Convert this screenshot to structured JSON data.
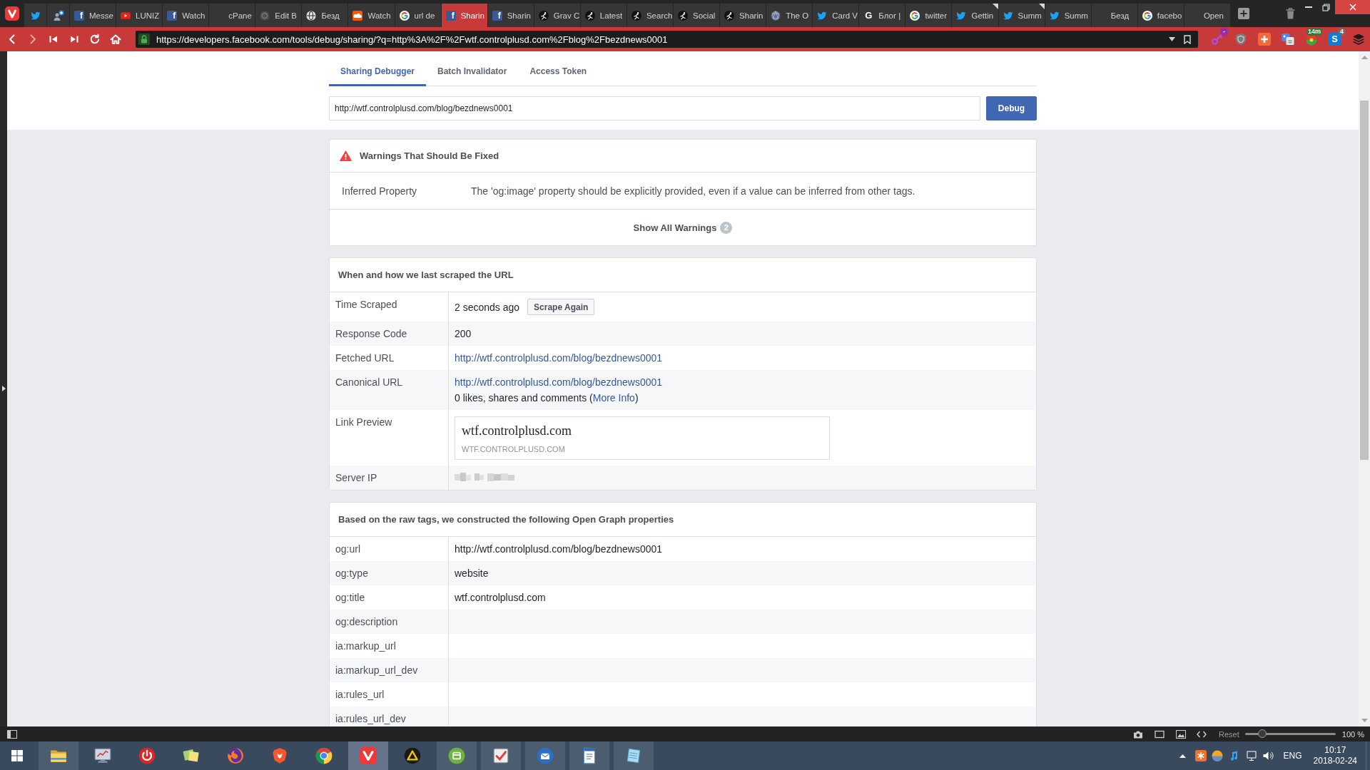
{
  "browser": {
    "pinned_tabs": [
      {
        "kind": "bird",
        "selected": false
      },
      {
        "kind": "people",
        "selected": false
      }
    ],
    "tabs": [
      {
        "kind": "letter",
        "glyph": "f",
        "label": "Messe",
        "selected": false,
        "marked": false
      },
      {
        "kind": "play",
        "label": "LUNIZ",
        "selected": false,
        "marked": false
      },
      {
        "kind": "letter",
        "glyph": "f",
        "label": "Watch",
        "selected": false,
        "marked": false
      },
      {
        "kind": "none",
        "label": "cPane",
        "selected": false,
        "marked": false
      },
      {
        "kind": "circle",
        "label": "Edit B",
        "selected": false,
        "marked": false
      },
      {
        "kind": "globe",
        "label": "Безд",
        "selected": false,
        "marked": false
      },
      {
        "kind": "cloud",
        "label": "Watch",
        "selected": false,
        "marked": false
      },
      {
        "kind": "ring",
        "label": "url de",
        "selected": false,
        "marked": false
      },
      {
        "kind": "letter",
        "glyph": "f",
        "label": "Sharin",
        "selected": true,
        "marked": false
      },
      {
        "kind": "letter",
        "glyph": "f",
        "label": "Sharin",
        "selected": false,
        "marked": false
      },
      {
        "kind": "figure",
        "label": "Grav C",
        "selected": false,
        "marked": false
      },
      {
        "kind": "figure",
        "label": "Latest",
        "selected": false,
        "marked": false
      },
      {
        "kind": "figure",
        "label": "Search",
        "selected": false,
        "marked": false
      },
      {
        "kind": "figure",
        "label": "Social",
        "selected": false,
        "marked": false
      },
      {
        "kind": "figure",
        "label": "Sharin",
        "selected": false,
        "marked": false
      },
      {
        "kind": "mesh",
        "label": "The O",
        "selected": false,
        "marked": false
      },
      {
        "kind": "bird",
        "label": "Card V",
        "selected": false,
        "marked": false
      },
      {
        "kind": "mono",
        "glyph": "G",
        "label": "Блог |",
        "selected": false,
        "marked": false
      },
      {
        "kind": "ring",
        "label": "twitter",
        "selected": false,
        "marked": false
      },
      {
        "kind": "bird",
        "label": "Gettin",
        "selected": false,
        "marked": true
      },
      {
        "kind": "bird",
        "label": "Summ",
        "selected": false,
        "marked": true
      },
      {
        "kind": "bird",
        "label": "Summ",
        "selected": false,
        "marked": false
      },
      {
        "kind": "none",
        "label": "Безд",
        "selected": false,
        "marked": false
      },
      {
        "kind": "ring",
        "label": "facebo",
        "selected": false,
        "marked": false
      },
      {
        "kind": "none",
        "label": "Open",
        "selected": false,
        "marked": false
      }
    ],
    "address_bar": {
      "nav": [
        {
          "kind": "back",
          "disabled": false
        },
        {
          "kind": "forward",
          "disabled": true
        },
        {
          "kind": "rewind",
          "disabled": false
        },
        {
          "kind": "fastforward",
          "disabled": false
        },
        {
          "kind": "reload",
          "disabled": false
        },
        {
          "kind": "home",
          "disabled": false
        }
      ],
      "secure": true,
      "url": "https://developers.facebook.com/tools/debug/sharing/?q=http%3A%2F%2Fwtf.controlplusd.com%2Fblog%2Fbezdnews0001",
      "extensions": [
        {
          "kind": "key",
          "badge": {
            "text": "-",
            "color": "#9c27b0"
          }
        },
        {
          "kind": "shield"
        },
        {
          "kind": "plus"
        },
        {
          "kind": "translate"
        },
        {
          "kind": "ball",
          "badge": {
            "text": "14m",
            "color": "#2e7d32"
          }
        },
        {
          "kind": "tile",
          "glyph": "S",
          "badge": {
            "text": "4",
            "color": "#6d6d6d"
          }
        },
        {
          "kind": "layers"
        }
      ]
    }
  },
  "page": {
    "tabs": [
      {
        "label": "Sharing Debugger",
        "selected": true
      },
      {
        "label": "Batch Invalidator",
        "selected": false
      },
      {
        "label": "Access Token",
        "selected": false
      }
    ],
    "url_input": {
      "value": "http://wtf.controlplusd.com/blog/bezdnews0001"
    },
    "debug_button": "Debug",
    "warnings": {
      "title": "Warnings That Should Be Fixed",
      "items": [
        {
          "name": "Inferred Property",
          "message": "The 'og:image' property should be explicitly provided, even if a value can be inferred from other tags."
        }
      ],
      "show_all": {
        "label": "Show All Warnings",
        "count": "2"
      }
    },
    "scrape": {
      "title": "When and how we last scraped the URL",
      "rows": [
        {
          "kind": "button",
          "label": "Time Scraped",
          "value": "2 seconds ago",
          "button": "Scrape Again"
        },
        {
          "kind": "text",
          "label": "Response Code",
          "value": "200"
        },
        {
          "kind": "link",
          "label": "Fetched URL",
          "value": "http://wtf.controlplusd.com/blog/bezdnews0001"
        },
        {
          "kind": "link",
          "label": "Canonical URL",
          "value": "http://wtf.controlplusd.com/blog/bezdnews0001",
          "note": {
            "text": "0 likes, shares and comments (",
            "link": "More Info",
            "after": ")"
          }
        },
        {
          "kind": "preview",
          "label": "Link Preview",
          "title": "wtf.controlplusd.com",
          "domain": "WTF.CONTROLPLUSD.COM"
        },
        {
          "kind": "redacted",
          "label": "Server IP"
        }
      ]
    },
    "open_graph": {
      "title": "Based on the raw tags, we constructed the following Open Graph properties",
      "rows": [
        {
          "property": "og:url",
          "value": "http://wtf.controlplusd.com/blog/bezdnews0001"
        },
        {
          "property": "og:type",
          "value": "website"
        },
        {
          "property": "og:title",
          "value": "wtf.controlplusd.com"
        },
        {
          "property": "og:description"
        },
        {
          "property": "ia:markup_url"
        },
        {
          "property": "ia:markup_url_dev"
        },
        {
          "property": "ia:rules_url"
        },
        {
          "property": "ia:rules_url_dev"
        }
      ]
    }
  },
  "status_bar": {
    "zoom": {
      "reset": "Reset",
      "level": 0.19,
      "value": "100 %"
    }
  },
  "taskbar": {
    "apps": [
      {
        "kind": "folder",
        "running": true,
        "selected": false
      },
      {
        "kind": "monitor",
        "running": false,
        "selected": false
      },
      {
        "kind": "power",
        "running": false,
        "selected": false
      },
      {
        "kind": "notes",
        "running": false,
        "selected": false
      },
      {
        "kind": "flame",
        "running": false,
        "selected": false
      },
      {
        "kind": "lion",
        "running": false,
        "selected": false
      },
      {
        "kind": "wheel",
        "running": false,
        "selected": false
      },
      {
        "kind": "chevron",
        "running": true,
        "selected": true
      },
      {
        "kind": "triangle",
        "running": false,
        "selected": false
      },
      {
        "kind": "box",
        "running": true,
        "selected": false
      },
      {
        "kind": "check",
        "running": true,
        "selected": false
      },
      {
        "kind": "envelope",
        "running": true,
        "selected": false
      },
      {
        "kind": "document",
        "running": true,
        "selected": false
      },
      {
        "kind": "notepad",
        "running": true,
        "selected": false
      }
    ],
    "tray": {
      "language": "ENG",
      "time": "10:17",
      "date": "2018-02-24"
    }
  }
}
